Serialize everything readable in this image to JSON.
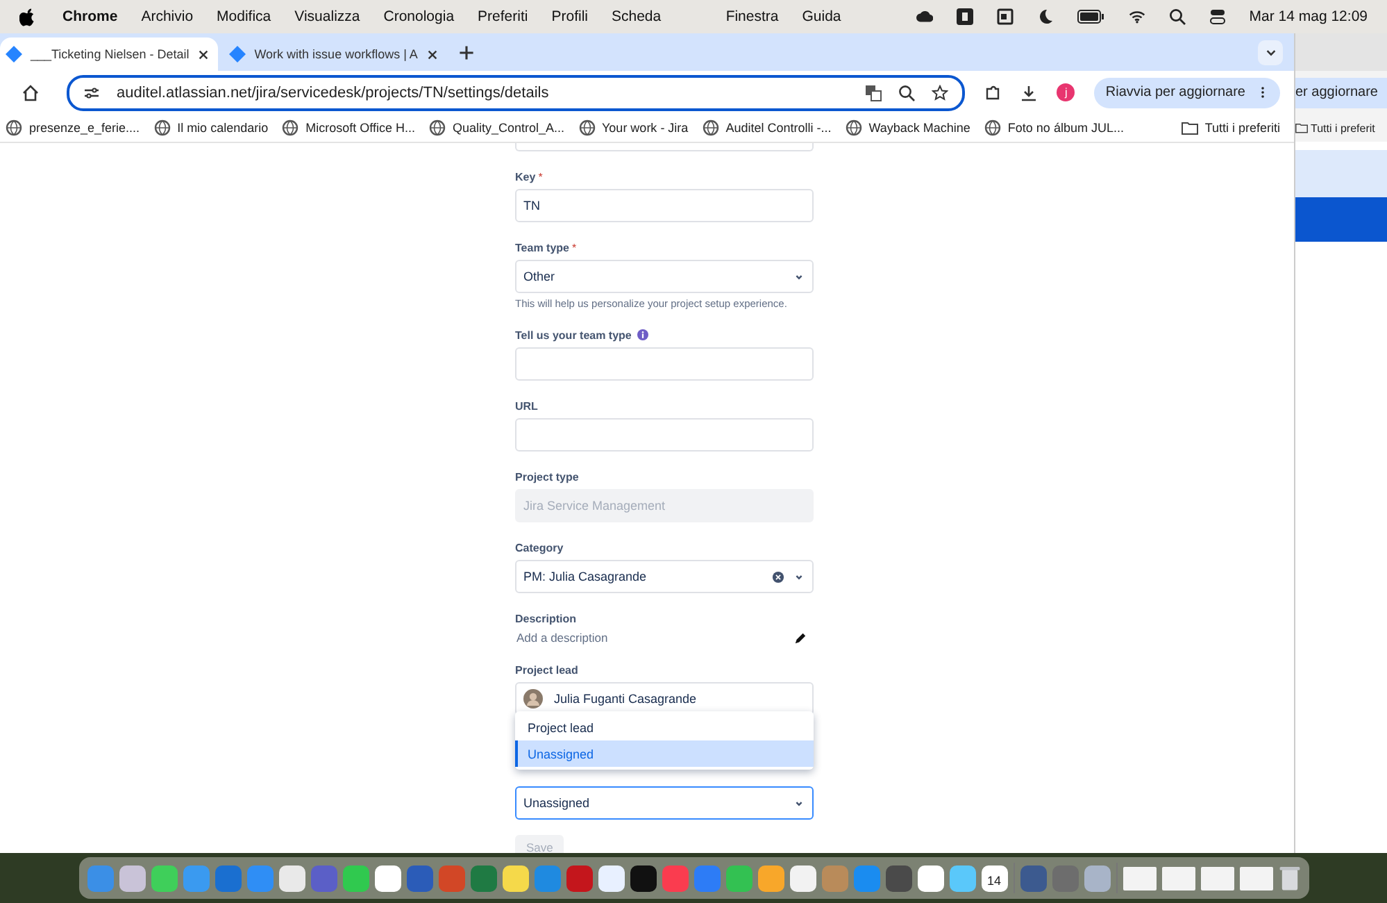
{
  "menubar": {
    "app": "Chrome",
    "menus": [
      "Archivio",
      "Modifica",
      "Visualizza",
      "Cronologia",
      "Preferiti",
      "Profili",
      "Scheda"
    ],
    "right_menus": [
      "Finestra",
      "Guida"
    ],
    "clock": "Mar 14 mag 12:09"
  },
  "tabs": [
    {
      "title": "___Ticketing Nielsen - Detail",
      "selected": true
    },
    {
      "title": "Work with issue workflows | A",
      "selected": false
    }
  ],
  "address": "auditel.atlassian.net/jira/servicedesk/projects/TN/settings/details",
  "profile_initial": "j",
  "update_button": "Riavvia per aggiornare",
  "bookmarks": [
    "presenze_e_ferie....",
    "Il mio calendario",
    "Microsoft Office H...",
    "Quality_Control_A...",
    "Your work - Jira",
    "Auditel Controlli -...",
    "Wayback Machine",
    "Foto no álbum JUL..."
  ],
  "all_bookmarks": "Tutti i preferiti",
  "fields": [
    {
      "kind": "text",
      "label": "Key",
      "required_mark": "*",
      "value": "TN"
    },
    {
      "kind": "select",
      "label": "Team type",
      "required_mark": "*",
      "value": "Other",
      "helper": "This will help us personalize your project setup experience."
    },
    {
      "kind": "text",
      "label": "Tell us your team type",
      "info": true
    },
    {
      "kind": "text",
      "label": "URL"
    },
    {
      "kind": "readonly",
      "label": "Project type",
      "value": "Jira Service Management"
    },
    {
      "kind": "select",
      "label": "Category",
      "value": "PM: Julia Casagrande",
      "clearable": true
    },
    {
      "kind": "description",
      "label": "Description",
      "placeholder": "Add a description"
    },
    {
      "kind": "user",
      "label": "Project lead",
      "value": "Julia Fuganti Casagrande"
    }
  ],
  "dropdown": {
    "options": [
      {
        "label": "Project lead",
        "selected": false
      },
      {
        "label": "Unassigned",
        "selected": true
      }
    ]
  },
  "assignee": {
    "value": "Unassigned",
    "focused": true
  },
  "save_button": {
    "label": "Save",
    "disabled": true
  },
  "background_window": {
    "update_button": "er aggiornare",
    "all_bookmarks": "Tutti i preferit"
  },
  "dock": {
    "calendar_day": "14"
  }
}
